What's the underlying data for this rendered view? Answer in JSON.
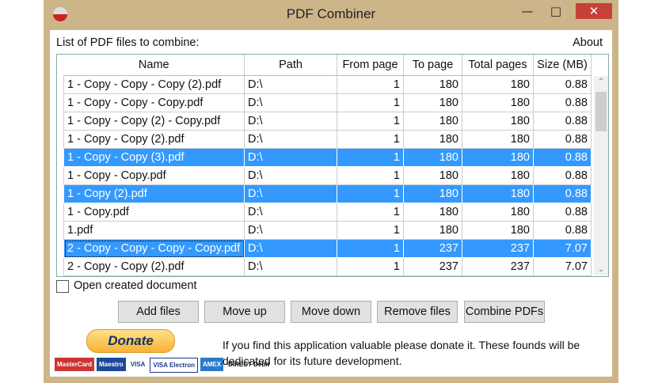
{
  "window": {
    "title": "PDF Combiner"
  },
  "labels": {
    "list": "List of PDF files to combine:",
    "about": "About",
    "open_created": "Open created document"
  },
  "columns": [
    "Name",
    "Path",
    "From page",
    "To page",
    "Total pages",
    "Size (MB)"
  ],
  "rows": [
    [
      "1 - Copy - Copy - Copy (2).pdf",
      "D:\\",
      "1",
      "180",
      "180",
      "0.88"
    ],
    [
      "1 - Copy - Copy - Copy.pdf",
      "D:\\",
      "1",
      "180",
      "180",
      "0.88"
    ],
    [
      "1 - Copy - Copy (2) - Copy.pdf",
      "D:\\",
      "1",
      "180",
      "180",
      "0.88"
    ],
    [
      "1 - Copy - Copy (2).pdf",
      "D:\\",
      "1",
      "180",
      "180",
      "0.88"
    ],
    [
      "1 - Copy - Copy (3).pdf",
      "D:\\",
      "1",
      "180",
      "180",
      "0.88"
    ],
    [
      "1 - Copy - Copy.pdf",
      "D:\\",
      "1",
      "180",
      "180",
      "0.88"
    ],
    [
      "1 - Copy (2).pdf",
      "D:\\",
      "1",
      "180",
      "180",
      "0.88"
    ],
    [
      "1 - Copy.pdf",
      "D:\\",
      "1",
      "180",
      "180",
      "0.88"
    ],
    [
      "1.pdf",
      "D:\\",
      "1",
      "180",
      "180",
      "0.88"
    ],
    [
      "2 - Copy - Copy - Copy - Copy.pdf",
      "D:\\",
      "1",
      "237",
      "237",
      "7.07"
    ],
    [
      "2 - Copy - Copy (2).pdf",
      "D:\\",
      "1",
      "237",
      "237",
      "7.07"
    ]
  ],
  "selected_rows": [
    4,
    6,
    9
  ],
  "buttons": {
    "add": "Add files",
    "up": "Move up",
    "down": "Move down",
    "remove": "Remove files",
    "combine": "Combine PDFs",
    "donate": "Donate"
  },
  "cards": [
    "MasterCard",
    "Maestro",
    "VISA",
    "VISA Electron",
    "AMEX",
    "DIRECT Debit"
  ],
  "message": "If you find this application valuable please donate it. These founds will be dedicated for its future development."
}
